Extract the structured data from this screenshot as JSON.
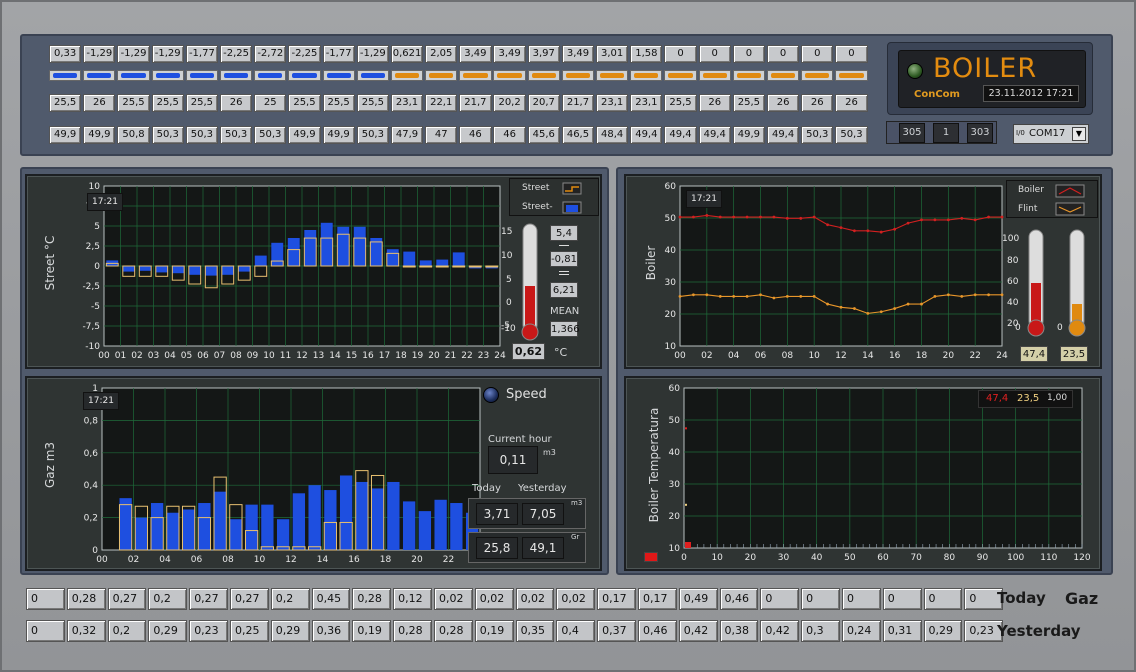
{
  "top": {
    "row1": [
      "0,33",
      "-1,29",
      "-1,29",
      "-1,29",
      "-1,77",
      "-2,25",
      "-2,72",
      "-2,25",
      "-1,77",
      "-1,29",
      "0,621",
      "2,05",
      "3,49",
      "3,49",
      "3,97",
      "3,49",
      "3,01",
      "1,58",
      "0",
      "0",
      "0",
      "0",
      "0",
      "0"
    ],
    "bar_colors": [
      "#1e4fe0",
      "#1e4fe0",
      "#1e4fe0",
      "#1e4fe0",
      "#1e4fe0",
      "#1e4fe0",
      "#1e4fe0",
      "#1e4fe0",
      "#1e4fe0",
      "#1e4fe0",
      "#e08a10",
      "#e08a10",
      "#e08a10",
      "#e08a10",
      "#e08a10",
      "#e08a10",
      "#e08a10",
      "#e08a10",
      "#e08a10",
      "#e08a10",
      "#e08a10",
      "#e08a10",
      "#e08a10",
      "#e08a10"
    ],
    "row2": [
      "25,5",
      "26",
      "25,5",
      "25,5",
      "25,5",
      "26",
      "25",
      "25,5",
      "25,5",
      "25,5",
      "23,1",
      "22,1",
      "21,7",
      "20,2",
      "20,7",
      "21,7",
      "23,1",
      "23,1",
      "25,5",
      "26",
      "25,5",
      "26",
      "26",
      "26"
    ],
    "row3": [
      "49,9",
      "49,9",
      "50,8",
      "50,3",
      "50,3",
      "50,3",
      "50,3",
      "49,9",
      "49,9",
      "50,3",
      "47,9",
      "47",
      "46",
      "46",
      "45,6",
      "46,5",
      "48,4",
      "49,4",
      "49,4",
      "49,4",
      "49,9",
      "49,4",
      "50,3",
      "50,3"
    ]
  },
  "logo": {
    "title": "BOILER",
    "brand": "ConCom",
    "datetime": "23.11.2012  17:21"
  },
  "status": {
    "v1": "305",
    "v2": "1",
    "v3": "303",
    "port_prefix": "I/0",
    "port": "COM17"
  },
  "street": {
    "ylabel": "Street °C",
    "time": "17:21",
    "legend": [
      "Street",
      "Street-"
    ],
    "values": {
      "max": "5,4",
      "min": "-0,81",
      "avg": "6,21",
      "mean": "1,366"
    },
    "mean_label": "MEAN",
    "current": "0,62",
    "unit": "°C"
  },
  "boiler": {
    "ylabel": "Boiler",
    "time": "17:21",
    "legend": [
      "Boiler",
      "Flint"
    ],
    "t1": "47,4",
    "t2": "23,5"
  },
  "gaz": {
    "ylabel": "Gaz m3",
    "time": "17:21",
    "speed_label": "Speed",
    "current_hour_label": "Current hour",
    "current_hour": "0,11",
    "m3": "m3",
    "today_label": "Today",
    "yesterday_label": "Yesterday",
    "today_m3": "3,71",
    "yesterday_m3": "7,05",
    "m3b": "m3",
    "today_gr": "25,8",
    "yesterday_gr": "49,1",
    "gr": "Gr"
  },
  "temp": {
    "ylabel": "Boiler Temperatura",
    "v1": "47,4",
    "v2": "23,5",
    "v3": "1,00"
  },
  "bottom": {
    "today": [
      "0",
      "0,28",
      "0,27",
      "0,2",
      "0,27",
      "0,27",
      "0,2",
      "0,45",
      "0,28",
      "0,12",
      "0,02",
      "0,02",
      "0,02",
      "0,02",
      "0,17",
      "0,17",
      "0,49",
      "0,46",
      "0",
      "0",
      "0",
      "0",
      "0",
      "0"
    ],
    "yesterday": [
      "0",
      "0,32",
      "0,2",
      "0,29",
      "0,23",
      "0,25",
      "0,29",
      "0,36",
      "0,19",
      "0,28",
      "0,28",
      "0,19",
      "0,35",
      "0,4",
      "0,37",
      "0,46",
      "0,42",
      "0,38",
      "0,42",
      "0,3",
      "0,24",
      "0,31",
      "0,29",
      "0,23"
    ],
    "today_label": "Today",
    "gaz_label": "Gaz",
    "yesterday_label": "Yesterday"
  },
  "chart_data": [
    {
      "type": "bar",
      "name": "Street",
      "title": "",
      "ylabel": "Street °C",
      "xlabel": "",
      "categories": [
        "00",
        "01",
        "02",
        "03",
        "04",
        "05",
        "06",
        "07",
        "08",
        "09",
        "10",
        "11",
        "12",
        "13",
        "14",
        "15",
        "16",
        "17",
        "18",
        "19",
        "20",
        "21",
        "22",
        "23",
        "24"
      ],
      "ylim": [
        -10,
        10
      ],
      "yticks": [
        "10",
        "7,5",
        "5",
        "2,5",
        "0",
        "-2,5",
        "-5",
        "-7,5",
        "-10"
      ],
      "series": [
        {
          "name": "Street",
          "values": [
            0.33,
            -1.29,
            -1.29,
            -1.29,
            -1.77,
            -2.25,
            -2.72,
            -2.25,
            -1.77,
            -1.29,
            0.62,
            2.05,
            3.49,
            3.49,
            3.97,
            3.49,
            3.01,
            1.58,
            0,
            0,
            0,
            0,
            0,
            0
          ]
        },
        {
          "name": "Street-",
          "values": [
            0.7,
            -0.7,
            -0.6,
            -0.8,
            -0.9,
            -1.1,
            -1.2,
            -1.1,
            -0.7,
            1.3,
            2.9,
            3.5,
            4.5,
            5.4,
            4.9,
            4.9,
            3.5,
            2.1,
            1.8,
            0.7,
            0.8,
            1.7,
            -0.3,
            -0.3
          ]
        }
      ]
    },
    {
      "type": "line",
      "name": "Boiler",
      "title": "",
      "ylabel": "Boiler",
      "xlabel": "",
      "x": [
        "00",
        "02",
        "04",
        "06",
        "08",
        "10",
        "12",
        "14",
        "16",
        "18",
        "20",
        "22",
        "24"
      ],
      "ylim": [
        10,
        60
      ],
      "yticks": [
        "60",
        "50",
        "40",
        "30",
        "20",
        "10"
      ],
      "series": [
        {
          "name": "Boiler",
          "values": [
            50.3,
            50.3,
            50.8,
            50.3,
            50.3,
            50.3,
            50.3,
            50.3,
            49.9,
            49.9,
            50.3,
            47.9,
            47,
            46,
            46,
            45.6,
            46.5,
            48.4,
            49.4,
            49.4,
            49.4,
            49.9,
            49.4,
            50.3,
            50.3
          ]
        },
        {
          "name": "Flint",
          "values": [
            25.5,
            26,
            26,
            25.5,
            25.5,
            25.5,
            26,
            25,
            25.5,
            25.5,
            25.5,
            23.1,
            22.1,
            21.7,
            20.2,
            20.7,
            21.7,
            23.1,
            23.1,
            25.5,
            26,
            25.5,
            26,
            26,
            26
          ]
        }
      ]
    },
    {
      "type": "bar",
      "name": "Gaz",
      "title": "",
      "ylabel": "Gaz m3",
      "xlabel": "",
      "categories": [
        "00",
        "01",
        "02",
        "03",
        "04",
        "05",
        "06",
        "07",
        "08",
        "09",
        "10",
        "11",
        "12",
        "13",
        "14",
        "15",
        "16",
        "17",
        "18",
        "19",
        "20",
        "21",
        "22",
        "23"
      ],
      "ylim": [
        0,
        1
      ],
      "yticks": [
        "1",
        "0,8",
        "0,6",
        "0,4",
        "0,2",
        "0"
      ],
      "series": [
        {
          "name": "Today",
          "values": [
            0,
            0.28,
            0.27,
            0.2,
            0.27,
            0.27,
            0.2,
            0.45,
            0.28,
            0.12,
            0.02,
            0.02,
            0.02,
            0.02,
            0.17,
            0.17,
            0.49,
            0.46,
            0,
            0,
            0,
            0,
            0,
            0
          ]
        },
        {
          "name": "Yesterday",
          "values": [
            0,
            0.32,
            0.2,
            0.29,
            0.23,
            0.25,
            0.29,
            0.36,
            0.19,
            0.28,
            0.28,
            0.19,
            0.35,
            0.4,
            0.37,
            0.46,
            0.42,
            0.38,
            0.42,
            0.3,
            0.24,
            0.31,
            0.29,
            0.23
          ]
        }
      ]
    },
    {
      "type": "scatter",
      "name": "Boiler Temperatura",
      "title": "",
      "ylabel": "Boiler Temperatura",
      "xlabel": "",
      "xlim": [
        0,
        120
      ],
      "xticks": [
        "0",
        "10",
        "20",
        "30",
        "40",
        "50",
        "60",
        "70",
        "80",
        "90",
        "100",
        "110",
        "120"
      ],
      "ylim": [
        10,
        60
      ],
      "yticks": [
        "60",
        "50",
        "40",
        "30",
        "20",
        "10"
      ],
      "series": [
        {
          "name": "Boiler",
          "values": [
            [
              0,
              47.4
            ]
          ]
        },
        {
          "name": "Flint",
          "values": [
            [
              0,
              23.5
            ]
          ]
        }
      ]
    }
  ],
  "colors": {
    "blue": "#1e4fe0",
    "orange": "#e08a10",
    "red": "#e02020",
    "boiler_line": "#d22020",
    "flint_line": "#e8962a",
    "grid": "#1e6b3a"
  }
}
